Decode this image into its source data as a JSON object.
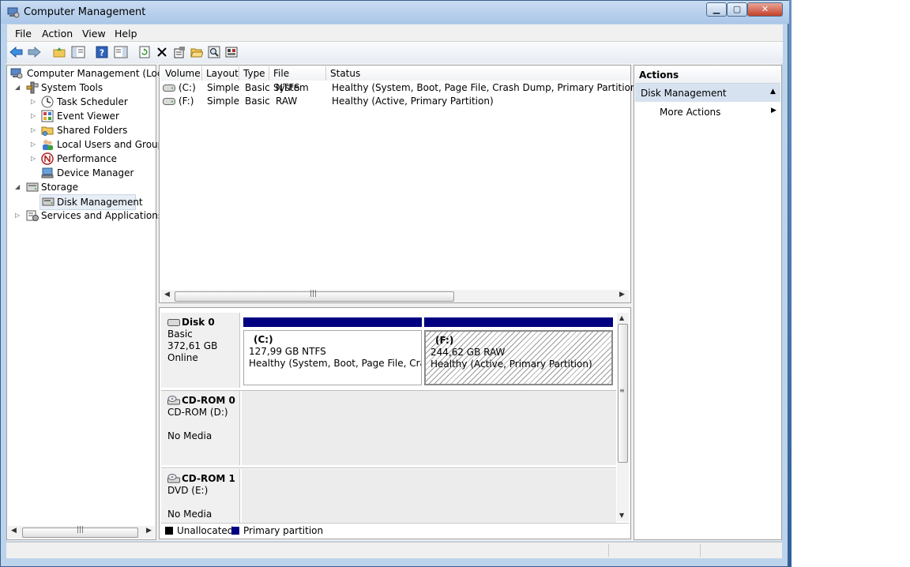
{
  "window": {
    "title": "Computer Management"
  },
  "menu": [
    "File",
    "Action",
    "View",
    "Help"
  ],
  "tree": [
    {
      "label": "Computer Management (Local",
      "icon": "computer-management-icon"
    },
    {
      "label": "System Tools",
      "icon": "system-tools-icon"
    },
    {
      "label": "Task Scheduler",
      "icon": "task-scheduler-icon"
    },
    {
      "label": "Event Viewer",
      "icon": "event-viewer-icon"
    },
    {
      "label": "Shared Folders",
      "icon": "shared-folders-icon"
    },
    {
      "label": "Local Users and Groups",
      "icon": "users-icon"
    },
    {
      "label": "Performance",
      "icon": "performance-icon"
    },
    {
      "label": "Device Manager",
      "icon": "device-manager-icon"
    },
    {
      "label": "Storage",
      "icon": "storage-icon"
    },
    {
      "label": "Disk Management",
      "icon": "disk-management-icon"
    },
    {
      "label": "Services and Applications",
      "icon": "services-icon"
    }
  ],
  "volumes": {
    "headers": [
      "Volume",
      "Layout",
      "Type",
      "File System",
      "Status"
    ],
    "rows": [
      [
        "(C:)",
        "Simple",
        "Basic",
        "NTFS",
        "Healthy (System, Boot, Page File, Crash Dump, Primary Partition)"
      ],
      [
        "(F:)",
        "Simple",
        "Basic",
        "RAW",
        "Healthy (Active, Primary Partition)"
      ]
    ]
  },
  "disks": [
    {
      "name": "Disk 0",
      "line1": "Basic",
      "line2": "372,61 GB",
      "line3": "Online",
      "partitions": [
        {
          "name": "(C:)",
          "size": "127,99 GB NTFS",
          "status": "Healthy (System, Boot, Page File, Crash D"
        },
        {
          "name": "(F:)",
          "size": "244,62 GB RAW",
          "status": "Healthy (Active, Primary Partition)"
        }
      ]
    },
    {
      "name": "CD-ROM 0",
      "line1": "CD-ROM (D:)",
      "line2": "",
      "line3": "No Media"
    },
    {
      "name": "CD-ROM 1",
      "line1": "DVD (E:)",
      "line2": "",
      "line3": "No Media"
    }
  ],
  "legend": [
    {
      "label": "Unallocated",
      "color": "#000000"
    },
    {
      "label": "Primary partition",
      "color": "#000080"
    }
  ],
  "actions": {
    "header": "Actions",
    "section": "Disk Management",
    "items": [
      "More Actions"
    ]
  },
  "colors": {
    "partition_bar": "#000080",
    "selection": "#e8eef6",
    "actions_section": "#d6e2f0"
  }
}
